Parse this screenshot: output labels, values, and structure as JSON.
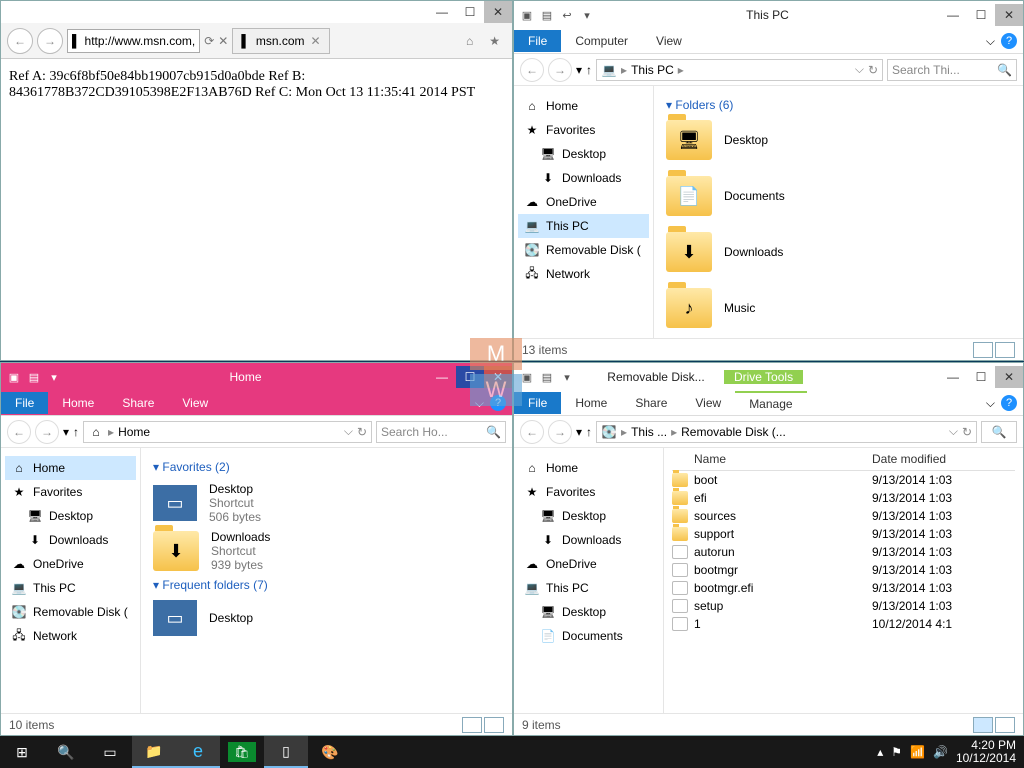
{
  "ie": {
    "url": "http://www.msn.com,",
    "tab_title": "msn.com",
    "body": "Ref A: 39c6f8bf50e84bb19007cb915d0a0bde Ref B: 84361778B372CD39105398E2F13AB76D Ref C: Mon Oct 13 11:35:41 2014 PST"
  },
  "thispc": {
    "title": "This PC",
    "tabs": {
      "file": "File",
      "computer": "Computer",
      "view": "View"
    },
    "breadcrumb": [
      "This PC"
    ],
    "search_ph": "Search Thi...",
    "nav": [
      "Home",
      "Favorites",
      "Desktop",
      "Downloads",
      "OneDrive",
      "This PC",
      "Removable Disk (",
      "Network"
    ],
    "nav_sel_index": 5,
    "group": "Folders (6)",
    "folders": [
      "Desktop",
      "Documents",
      "Downloads",
      "Music"
    ],
    "status": "13 items"
  },
  "home": {
    "title": "Home",
    "tabs": {
      "file": "File",
      "home": "Home",
      "share": "Share",
      "view": "View"
    },
    "breadcrumb": [
      "Home"
    ],
    "search_ph": "Search Ho...",
    "nav": [
      "Home",
      "Favorites",
      "Desktop",
      "Downloads",
      "OneDrive",
      "This PC",
      "Removable Disk (",
      "Network"
    ],
    "nav_sel_index": 0,
    "groups": {
      "fav": {
        "header": "Favorites (2)",
        "items": [
          {
            "name": "Desktop",
            "sub": "Shortcut",
            "size": "506 bytes"
          },
          {
            "name": "Downloads",
            "sub": "Shortcut",
            "size": "939 bytes"
          }
        ]
      },
      "freq": {
        "header": "Frequent folders (7)",
        "items": [
          {
            "name": "Desktop"
          }
        ]
      }
    },
    "status": "10 items"
  },
  "remdisk": {
    "title": "Removable Disk...",
    "ctx": "Drive Tools",
    "tabs": {
      "file": "File",
      "home": "Home",
      "share": "Share",
      "view": "View",
      "manage": "Manage"
    },
    "breadcrumb": [
      "This ...",
      "Removable Disk (..."
    ],
    "search_ph": "",
    "nav": [
      "Home",
      "Favorites",
      "Desktop",
      "Downloads",
      "OneDrive",
      "This PC",
      "Desktop",
      "Documents"
    ],
    "cols": {
      "name": "Name",
      "date": "Date modified"
    },
    "rows": [
      {
        "ico": "folder",
        "name": "boot",
        "date": "9/13/2014 1:03"
      },
      {
        "ico": "folder",
        "name": "efi",
        "date": "9/13/2014 1:03"
      },
      {
        "ico": "folder",
        "name": "sources",
        "date": "9/13/2014 1:03"
      },
      {
        "ico": "folder",
        "name": "support",
        "date": "9/13/2014 1:03"
      },
      {
        "ico": "file",
        "name": "autorun",
        "date": "9/13/2014 1:03"
      },
      {
        "ico": "file",
        "name": "bootmgr",
        "date": "9/13/2014 1:03"
      },
      {
        "ico": "file",
        "name": "bootmgr.efi",
        "date": "9/13/2014 1:03"
      },
      {
        "ico": "file",
        "name": "setup",
        "date": "9/13/2014 1:03"
      },
      {
        "ico": "file",
        "name": "1",
        "date": "10/12/2014 4:1"
      }
    ],
    "status": "9 items"
  },
  "taskbar": {
    "time": "4:20 PM",
    "date": "10/12/2014"
  }
}
